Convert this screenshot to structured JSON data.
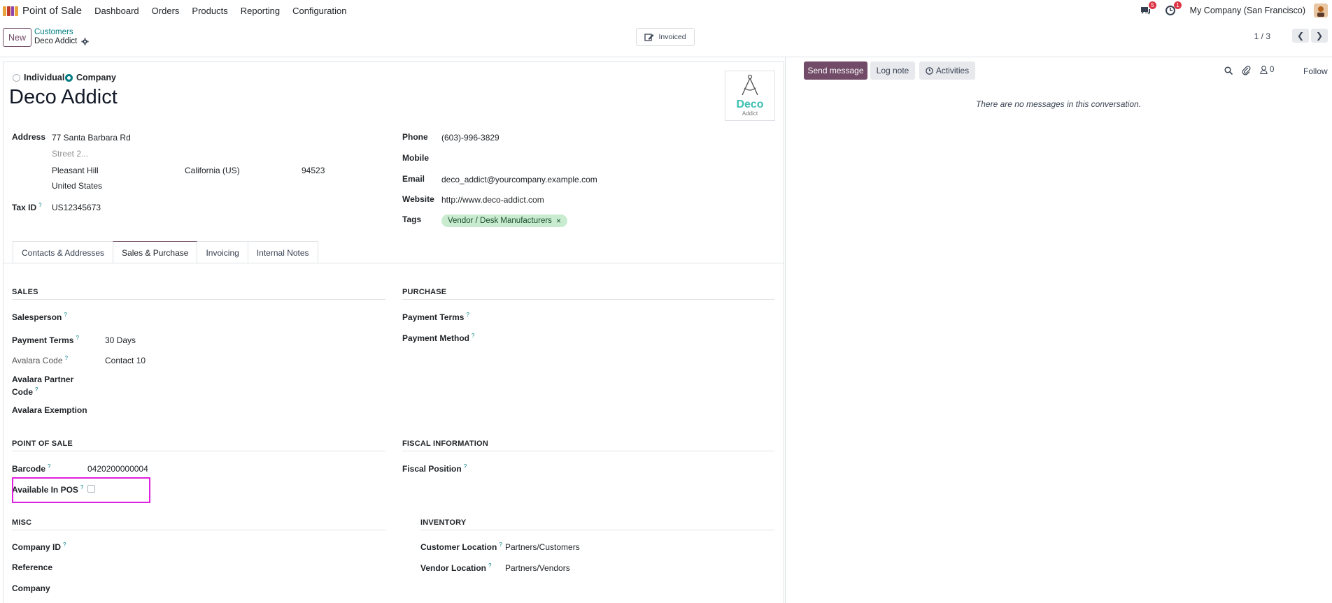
{
  "topbar": {
    "app_name": "Point of Sale",
    "menu": [
      "Dashboard",
      "Orders",
      "Products",
      "Reporting",
      "Configuration"
    ],
    "messages_badge": "5",
    "activities_badge": "1",
    "company": "My Company (San Francisco)"
  },
  "control_panel": {
    "new_label": "New",
    "breadcrumb_parent": "Customers",
    "breadcrumb_current": "Deco Addict",
    "smart_button_label": "Invoiced",
    "pager": "1 / 3"
  },
  "form": {
    "type_individual": "Individual",
    "type_company": "Company",
    "selected_type": "Company",
    "name": "Deco Addict",
    "logo_text_1": "Deco",
    "logo_text_2": "Addict",
    "address_label": "Address",
    "street": "77 Santa Barbara Rd",
    "street2_placeholder": "Street 2...",
    "city": "Pleasant Hill",
    "state": "California (US)",
    "zip": "94523",
    "country": "United States",
    "tax_id_label": "Tax ID",
    "tax_id": "US12345673",
    "phone_label": "Phone",
    "phone": "(603)-996-3829",
    "mobile_label": "Mobile",
    "email_label": "Email",
    "email": "deco_addict@yourcompany.example.com",
    "website_label": "Website",
    "website": "http://www.deco-addict.com",
    "tags_label": "Tags",
    "tag": "Vendor / Desk Manufacturers"
  },
  "tabs": [
    "Contacts & Addresses",
    "Sales & Purchase",
    "Invoicing",
    "Internal Notes"
  ],
  "active_tab": "Sales & Purchase",
  "sales": {
    "title": "SALES",
    "salesperson_label": "Salesperson",
    "payment_terms_label": "Payment Terms",
    "payment_terms": "30 Days",
    "avalara_code_label": "Avalara Code",
    "avalara_code": "Contact 10",
    "avalara_partner_label_1": "Avalara Partner",
    "avalara_partner_label_2": "Code",
    "avalara_exemption_label": "Avalara Exemption"
  },
  "purchase": {
    "title": "PURCHASE",
    "payment_terms_label": "Payment Terms",
    "payment_method_label": "Payment Method"
  },
  "pos": {
    "title": "POINT OF SALE",
    "barcode_label": "Barcode",
    "barcode": "0420200000004",
    "available_label": "Available In POS",
    "available_checked": false
  },
  "fiscal": {
    "title": "FISCAL INFORMATION",
    "fiscal_position_label": "Fiscal Position"
  },
  "misc": {
    "title": "MISC",
    "company_id_label": "Company ID",
    "reference_label": "Reference",
    "company_label": "Company"
  },
  "inventory": {
    "title": "INVENTORY",
    "customer_location_label": "Customer Location",
    "customer_location": "Partners/Customers",
    "vendor_location_label": "Vendor Location",
    "vendor_location": "Partners/Vendors"
  },
  "chatter": {
    "send_message": "Send message",
    "log_note": "Log note",
    "activities": "Activities",
    "followers_count": "0",
    "follow": "Follow",
    "empty_text": "There are no messages in this conversation."
  },
  "colors": {
    "primary": "#714b67",
    "link": "#017e84",
    "tag_bg": "#c9ecd1",
    "highlight": "#e020e0"
  },
  "help_mark": "?"
}
